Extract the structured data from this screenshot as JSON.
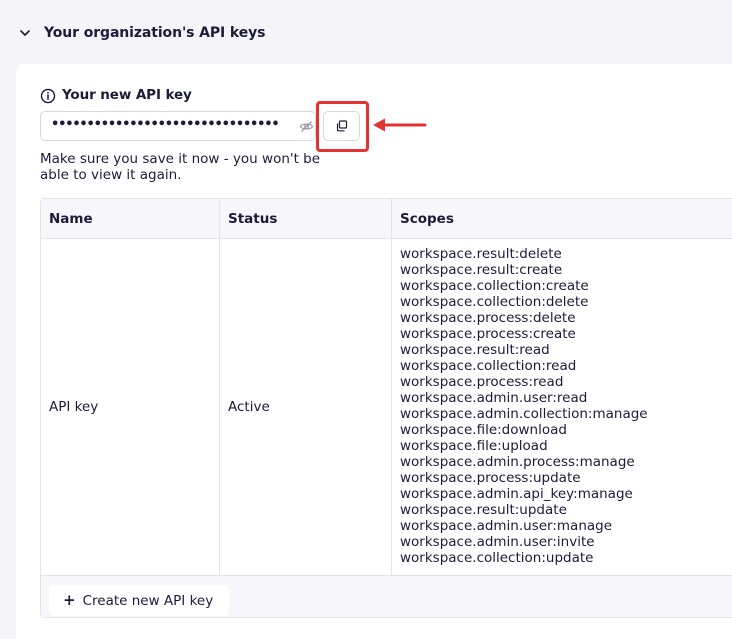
{
  "section": {
    "title": "Your organization's API keys",
    "icon": "chevron-down-icon"
  },
  "new_key": {
    "title": "Your new API key",
    "value": "••••••••••••••••••••••••••••••••",
    "note": "Make sure you save it now - you won't be able to view it again.",
    "copy_icon": "copy-icon",
    "visibility_icon": "eye-off-icon"
  },
  "table": {
    "headers": {
      "name": "Name",
      "status": "Status",
      "scopes": "Scopes"
    },
    "rows": [
      {
        "name": "API key",
        "status": "Active",
        "scopes": [
          "workspace.result:delete",
          "workspace.result:create",
          "workspace.collection:create",
          "workspace.collection:delete",
          "workspace.process:delete",
          "workspace.process:create",
          "workspace.result:read",
          "workspace.collection:read",
          "workspace.process:read",
          "workspace.admin.user:read",
          "workspace.admin.collection:manage",
          "workspace.file:download",
          "workspace.file:upload",
          "workspace.admin.process:manage",
          "workspace.process:update",
          "workspace.admin.api_key:manage",
          "workspace.result:update",
          "workspace.admin.user:manage",
          "workspace.admin.user:invite",
          "workspace.collection:update"
        ]
      }
    ]
  },
  "footer": {
    "create_label": "Create new API key",
    "create_icon": "plus-icon"
  },
  "colors": {
    "text": "#1d1b3a",
    "highlight": "#e03434",
    "background": "#f5f4f8"
  }
}
